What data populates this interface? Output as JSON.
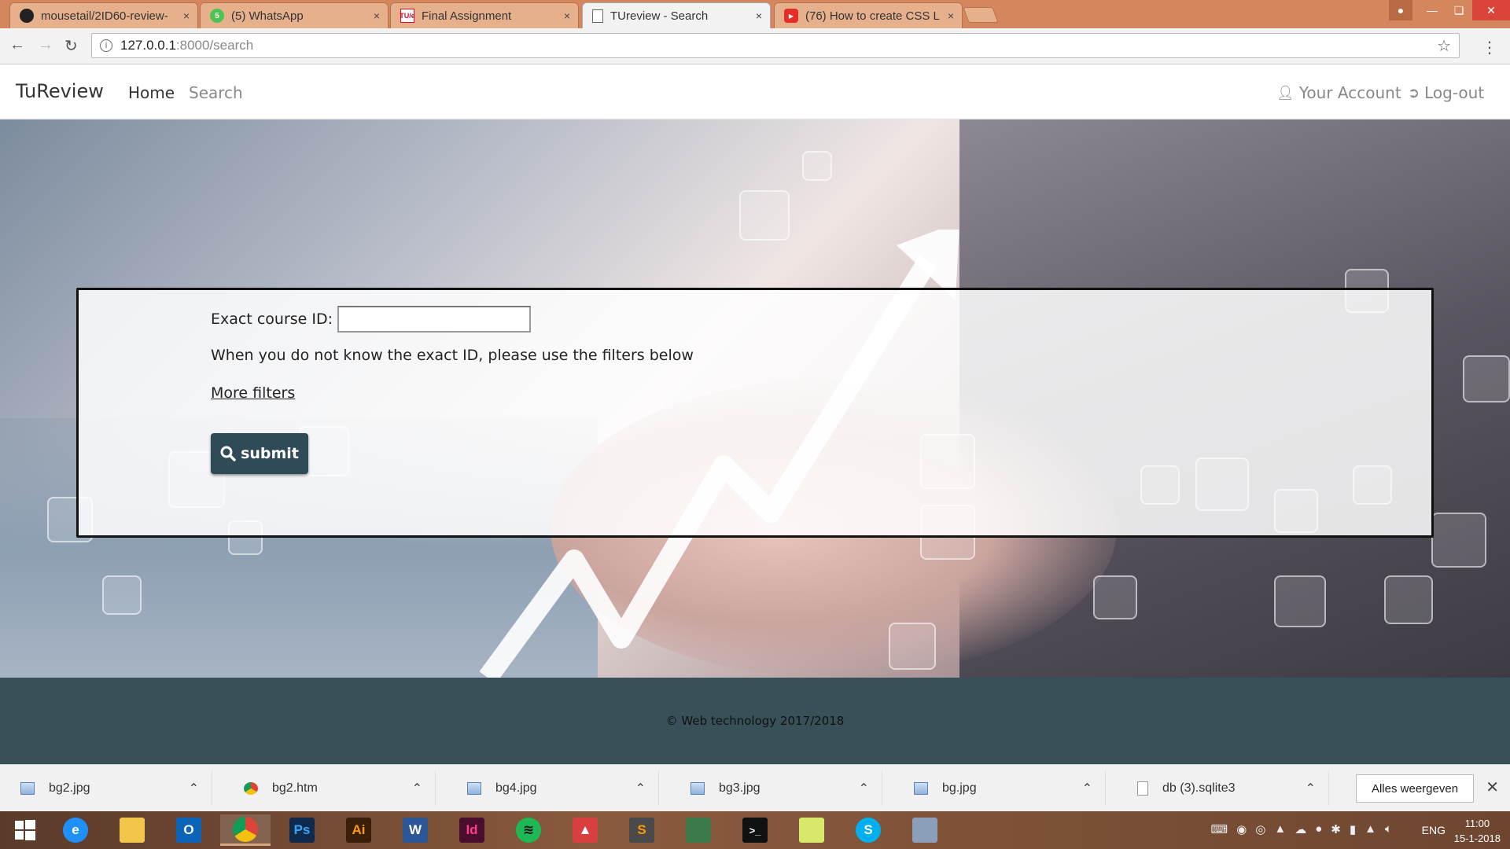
{
  "browser": {
    "tabs": [
      {
        "title": "mousetail/2ID60-review-",
        "icon": "github-icon",
        "glyph": ""
      },
      {
        "title": "(5) WhatsApp",
        "icon": "whatsapp-icon",
        "glyph": "5"
      },
      {
        "title": "Final Assignment",
        "icon": "tue-icon",
        "glyph": "TU/e"
      },
      {
        "title": "TUreview - Search",
        "icon": "page-icon",
        "glyph": ""
      },
      {
        "title": "(76) How to create CSS L",
        "icon": "youtube-icon",
        "glyph": "▶"
      }
    ],
    "active_tab": 3,
    "tab_close": "×",
    "url_host": "127.0.0.1",
    "url_path": ":8000/search"
  },
  "site": {
    "brand": "TuReview",
    "nav": {
      "home": "Home",
      "search": "Search",
      "account": "Your Account",
      "logout": "Log-out"
    },
    "form": {
      "course_id_label": "Exact course ID:",
      "course_id_value": "",
      "hint": "When you do not know the exact ID, please use the filters below",
      "more_filters": "More filters",
      "submit": "submit"
    },
    "footer": "© Web technology 2017/2018"
  },
  "downloads": {
    "items": [
      {
        "name": "bg2.jpg",
        "type": "image"
      },
      {
        "name": "bg2.htm",
        "type": "chrome"
      },
      {
        "name": "bg4.jpg",
        "type": "image"
      },
      {
        "name": "bg3.jpg",
        "type": "image"
      },
      {
        "name": "bg.jpg",
        "type": "image"
      },
      {
        "name": "db (3).sqlite3",
        "type": "file"
      }
    ],
    "show_all": "Alles weergeven"
  },
  "taskbar": {
    "apps": [
      {
        "name": "windows-start-icon",
        "label": "",
        "color": "#ffffff"
      },
      {
        "name": "internet-explorer-icon",
        "label": "e",
        "color": "#1e90ff"
      },
      {
        "name": "file-explorer-icon",
        "label": "",
        "color": "#f3c64b"
      },
      {
        "name": "outlook-icon",
        "label": "O",
        "color": "#0a64b8"
      },
      {
        "name": "chrome-icon",
        "label": "",
        "color": "#db4437"
      },
      {
        "name": "photoshop-icon",
        "label": "Ps",
        "color": "#0f2a4a"
      },
      {
        "name": "illustrator-icon",
        "label": "Ai",
        "color": "#3a1f0a"
      },
      {
        "name": "word-icon",
        "label": "W",
        "color": "#2b5797"
      },
      {
        "name": "indesign-icon",
        "label": "Id",
        "color": "#4a0d2c"
      },
      {
        "name": "spotify-icon",
        "label": "≋",
        "color": "#1db954"
      },
      {
        "name": "popcorn-time-icon",
        "label": "▲",
        "color": "#d84040"
      },
      {
        "name": "sublime-text-icon",
        "label": "S",
        "color": "#4a4a4a"
      },
      {
        "name": "task-switch-icon",
        "label": "",
        "color": "#3c7a4a"
      },
      {
        "name": "terminal-icon",
        "label": ">_",
        "color": "#111111"
      },
      {
        "name": "sticky-notes-icon",
        "label": "",
        "color": "#d9e86a"
      },
      {
        "name": "skype-icon",
        "label": "S",
        "color": "#00aff0"
      },
      {
        "name": "calculator-icon",
        "label": "",
        "color": "#8aa0b8"
      }
    ],
    "language": "ENG",
    "time": "11:00",
    "date": "15-1-2018"
  }
}
